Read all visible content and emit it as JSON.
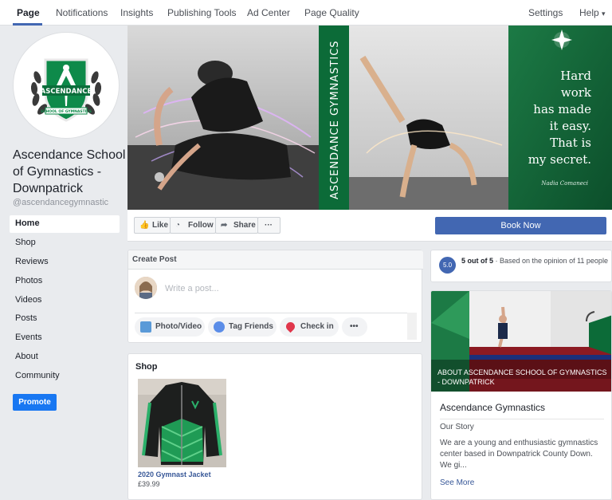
{
  "topnav": {
    "tabs": [
      "Page",
      "Notifications",
      "Insights",
      "Publishing Tools",
      "Ad Center",
      "Page Quality"
    ],
    "settings": "Settings",
    "help": "Help",
    "help_caret": "▾"
  },
  "sidebar": {
    "logo_text": "ASCENDANCE",
    "logo_sub": "SCHOOL OF GYMNASTICS",
    "page_name": "Ascendance School of Gymnastics - Downpatrick",
    "handle": "@ascendancegymnastic",
    "items": [
      "Home",
      "Shop",
      "Reviews",
      "Photos",
      "Videos",
      "Posts",
      "Events",
      "About",
      "Community"
    ],
    "promote": "Promote"
  },
  "cover": {
    "banner_text": "ASCENDANCE GYMNASTICS",
    "quote_lines": [
      "Hard",
      "work",
      "has made",
      "it easy.",
      "That is",
      "my secret."
    ],
    "signature": "Nadia Comaneci"
  },
  "actions": {
    "like": "Like",
    "follow": "Follow",
    "share": "Share",
    "more": "···",
    "book": "Book Now"
  },
  "composer": {
    "header": "Create Post",
    "placeholder": "Write a post...",
    "photo_video": "Photo/Video",
    "tag_friends": "Tag Friends",
    "check_in": "Check in",
    "more": "•••"
  },
  "shop": {
    "title": "Shop",
    "product_name": "2020 Gymnast Jacket",
    "product_price": "£39.99"
  },
  "rating": {
    "score": "5.0",
    "bold": "5 out of 5",
    "rest": " · Based on the opinion of 11 people"
  },
  "about": {
    "caption": "ABOUT ASCENDANCE SCHOOL OF GYMNASTICS - DOWNPATRICK",
    "title": "Ascendance Gymnastics",
    "story": "Our Story",
    "desc": "We are a young and enthusiastic gymnastics center based in Downpatrick County Down. We gi...",
    "more": "See More"
  },
  "colors": {
    "brand_blue": "#4267b2",
    "promote_blue": "#1877f2",
    "accent_green": "#0e8a4a"
  }
}
